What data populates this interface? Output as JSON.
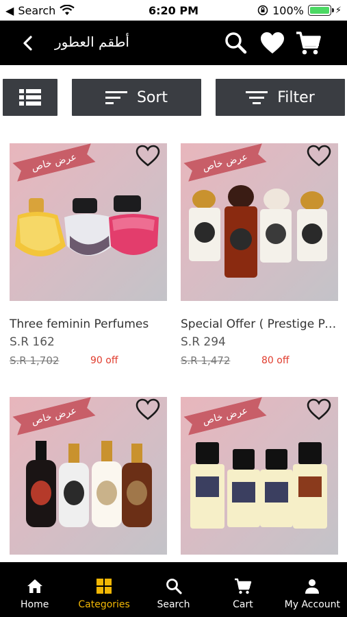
{
  "status": {
    "back_app": "Search",
    "time": "6:20 PM",
    "battery": "100%"
  },
  "header": {
    "title": "أطقم العطور"
  },
  "toolbar": {
    "sort_label": "Sort",
    "filter_label": "Filter"
  },
  "products": [
    {
      "badge": "عرض خاص",
      "name": "Three feminin Perfumes",
      "price": "S.R 162",
      "old_price": "S.R 1,702",
      "discount": "90 off"
    },
    {
      "badge": "عرض خاص",
      "name": "Special Offer ( Prestige Pe...",
      "price": "S.R 294",
      "old_price": "S.R 1,472",
      "discount": "80 off"
    },
    {
      "badge": "عرض خاص"
    },
    {
      "badge": "عرض خاص"
    }
  ],
  "nav": {
    "items": [
      {
        "label": "Home",
        "icon": "home-icon"
      },
      {
        "label": "Categories",
        "icon": "grid-icon",
        "active": true
      },
      {
        "label": "Search",
        "icon": "search-icon"
      },
      {
        "label": "Cart",
        "icon": "cart-icon"
      },
      {
        "label": "My Account",
        "icon": "person-icon"
      }
    ]
  },
  "colors": {
    "accent": "#f2b705",
    "discount": "#e03b2c",
    "toolbar": "#3a3d42",
    "ribbon": "#c85e68"
  }
}
